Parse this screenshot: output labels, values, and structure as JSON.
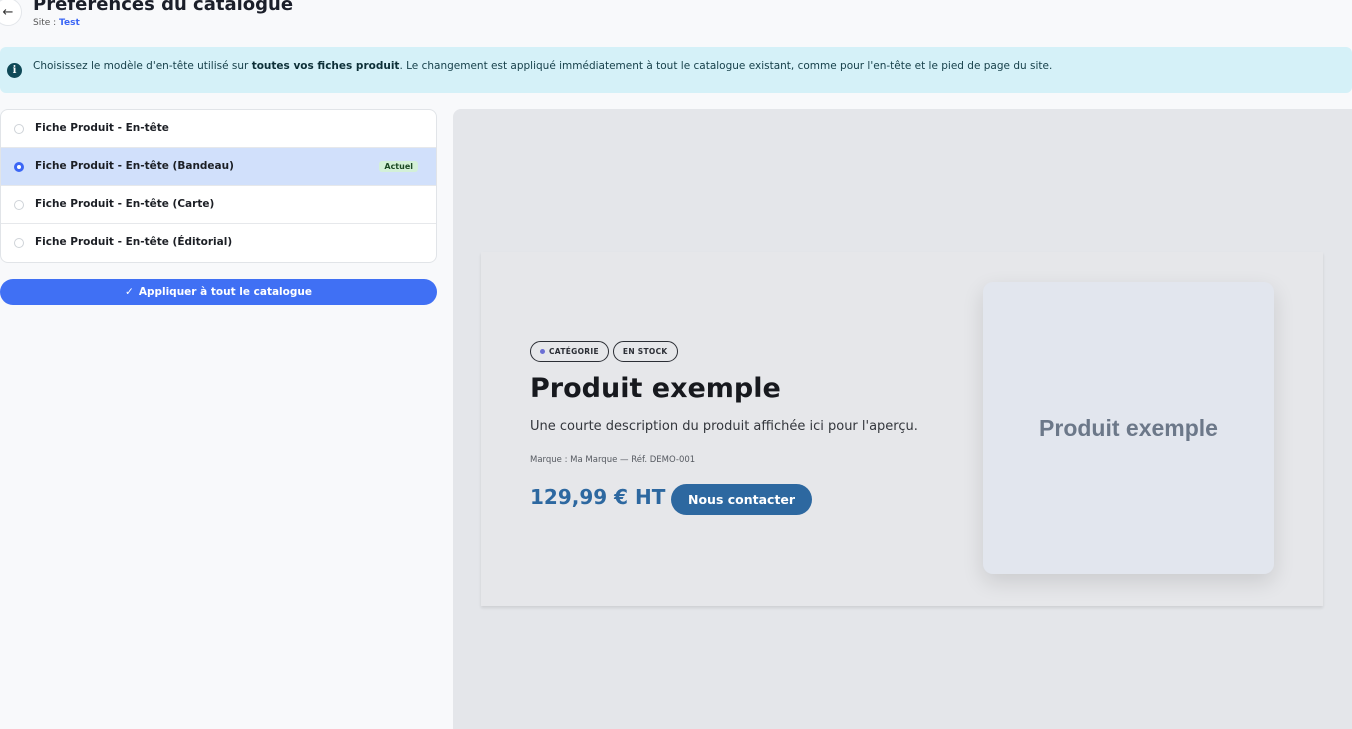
{
  "header": {
    "back_icon": "arrow-left-icon",
    "title": "Préférences du catalogue",
    "site_prefix": "Site : ",
    "site_name": "Test"
  },
  "info_banner": {
    "icon": "info-icon",
    "text_before": "Choisissez le modèle d'en-tête utilisé sur ",
    "text_bold": "toutes vos fiches produit",
    "text_after": ". Le changement est appliqué immédiatement à tout le catalogue existant, comme pour l'en-tête et le pied de page du site."
  },
  "templates": {
    "items": [
      {
        "label": "Fiche Produit - En-tête",
        "selected": false
      },
      {
        "label": "Fiche Produit - En-tête (Bandeau)",
        "selected": true,
        "badge": "Actuel"
      },
      {
        "label": "Fiche Produit - En-tête (Carte)",
        "selected": false
      },
      {
        "label": "Fiche Produit - En-tête (Éditorial)",
        "selected": false
      }
    ]
  },
  "apply_button": {
    "icon": "check-icon",
    "label": "Appliquer à tout le catalogue"
  },
  "preview": {
    "pill_category": "CATÉGORIE",
    "pill_stock": "EN STOCK",
    "title": "Produit exemple",
    "description": "Une courte description du produit affichée ici pour l'aperçu.",
    "meta": "Marque : Ma Marque — Réf. DEMO-001",
    "price": "129,99 € HT",
    "contact_label": "Nous contacter",
    "image_label": "Produit exemple"
  },
  "colors": {
    "accent": "#4070f4",
    "price": "#2d68a0",
    "banner_bg": "#d5f1f8",
    "selected_bg": "#d1e0fb"
  }
}
